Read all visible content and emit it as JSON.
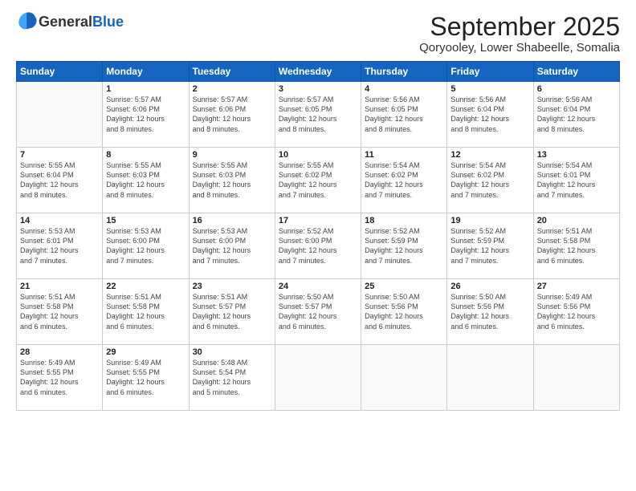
{
  "logo": {
    "general": "General",
    "blue": "Blue"
  },
  "header": {
    "month": "September 2025",
    "location": "Qoryooley, Lower Shabeelle, Somalia"
  },
  "weekdays": [
    "Sunday",
    "Monday",
    "Tuesday",
    "Wednesday",
    "Thursday",
    "Friday",
    "Saturday"
  ],
  "weeks": [
    [
      {
        "day": "",
        "info": ""
      },
      {
        "day": "1",
        "info": "Sunrise: 5:57 AM\nSunset: 6:06 PM\nDaylight: 12 hours\nand 8 minutes."
      },
      {
        "day": "2",
        "info": "Sunrise: 5:57 AM\nSunset: 6:06 PM\nDaylight: 12 hours\nand 8 minutes."
      },
      {
        "day": "3",
        "info": "Sunrise: 5:57 AM\nSunset: 6:05 PM\nDaylight: 12 hours\nand 8 minutes."
      },
      {
        "day": "4",
        "info": "Sunrise: 5:56 AM\nSunset: 6:05 PM\nDaylight: 12 hours\nand 8 minutes."
      },
      {
        "day": "5",
        "info": "Sunrise: 5:56 AM\nSunset: 6:04 PM\nDaylight: 12 hours\nand 8 minutes."
      },
      {
        "day": "6",
        "info": "Sunrise: 5:56 AM\nSunset: 6:04 PM\nDaylight: 12 hours\nand 8 minutes."
      }
    ],
    [
      {
        "day": "7",
        "info": "Sunrise: 5:55 AM\nSunset: 6:04 PM\nDaylight: 12 hours\nand 8 minutes."
      },
      {
        "day": "8",
        "info": "Sunrise: 5:55 AM\nSunset: 6:03 PM\nDaylight: 12 hours\nand 8 minutes."
      },
      {
        "day": "9",
        "info": "Sunrise: 5:55 AM\nSunset: 6:03 PM\nDaylight: 12 hours\nand 8 minutes."
      },
      {
        "day": "10",
        "info": "Sunrise: 5:55 AM\nSunset: 6:02 PM\nDaylight: 12 hours\nand 7 minutes."
      },
      {
        "day": "11",
        "info": "Sunrise: 5:54 AM\nSunset: 6:02 PM\nDaylight: 12 hours\nand 7 minutes."
      },
      {
        "day": "12",
        "info": "Sunrise: 5:54 AM\nSunset: 6:02 PM\nDaylight: 12 hours\nand 7 minutes."
      },
      {
        "day": "13",
        "info": "Sunrise: 5:54 AM\nSunset: 6:01 PM\nDaylight: 12 hours\nand 7 minutes."
      }
    ],
    [
      {
        "day": "14",
        "info": "Sunrise: 5:53 AM\nSunset: 6:01 PM\nDaylight: 12 hours\nand 7 minutes."
      },
      {
        "day": "15",
        "info": "Sunrise: 5:53 AM\nSunset: 6:00 PM\nDaylight: 12 hours\nand 7 minutes."
      },
      {
        "day": "16",
        "info": "Sunrise: 5:53 AM\nSunset: 6:00 PM\nDaylight: 12 hours\nand 7 minutes."
      },
      {
        "day": "17",
        "info": "Sunrise: 5:52 AM\nSunset: 6:00 PM\nDaylight: 12 hours\nand 7 minutes."
      },
      {
        "day": "18",
        "info": "Sunrise: 5:52 AM\nSunset: 5:59 PM\nDaylight: 12 hours\nand 7 minutes."
      },
      {
        "day": "19",
        "info": "Sunrise: 5:52 AM\nSunset: 5:59 PM\nDaylight: 12 hours\nand 7 minutes."
      },
      {
        "day": "20",
        "info": "Sunrise: 5:51 AM\nSunset: 5:58 PM\nDaylight: 12 hours\nand 6 minutes."
      }
    ],
    [
      {
        "day": "21",
        "info": "Sunrise: 5:51 AM\nSunset: 5:58 PM\nDaylight: 12 hours\nand 6 minutes."
      },
      {
        "day": "22",
        "info": "Sunrise: 5:51 AM\nSunset: 5:58 PM\nDaylight: 12 hours\nand 6 minutes."
      },
      {
        "day": "23",
        "info": "Sunrise: 5:51 AM\nSunset: 5:57 PM\nDaylight: 12 hours\nand 6 minutes."
      },
      {
        "day": "24",
        "info": "Sunrise: 5:50 AM\nSunset: 5:57 PM\nDaylight: 12 hours\nand 6 minutes."
      },
      {
        "day": "25",
        "info": "Sunrise: 5:50 AM\nSunset: 5:56 PM\nDaylight: 12 hours\nand 6 minutes."
      },
      {
        "day": "26",
        "info": "Sunrise: 5:50 AM\nSunset: 5:56 PM\nDaylight: 12 hours\nand 6 minutes."
      },
      {
        "day": "27",
        "info": "Sunrise: 5:49 AM\nSunset: 5:56 PM\nDaylight: 12 hours\nand 6 minutes."
      }
    ],
    [
      {
        "day": "28",
        "info": "Sunrise: 5:49 AM\nSunset: 5:55 PM\nDaylight: 12 hours\nand 6 minutes."
      },
      {
        "day": "29",
        "info": "Sunrise: 5:49 AM\nSunset: 5:55 PM\nDaylight: 12 hours\nand 6 minutes."
      },
      {
        "day": "30",
        "info": "Sunrise: 5:48 AM\nSunset: 5:54 PM\nDaylight: 12 hours\nand 5 minutes."
      },
      {
        "day": "",
        "info": ""
      },
      {
        "day": "",
        "info": ""
      },
      {
        "day": "",
        "info": ""
      },
      {
        "day": "",
        "info": ""
      }
    ]
  ]
}
